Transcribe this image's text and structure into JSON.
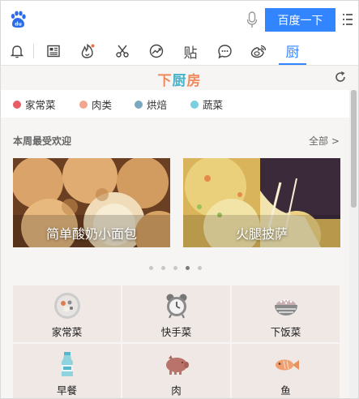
{
  "search": {
    "placeholder": "",
    "value": "",
    "button_label": "百度一下"
  },
  "toolbar": {
    "items": [
      {
        "icon": "bell-icon"
      },
      {
        "icon": "news-icon"
      },
      {
        "icon": "fire-icon"
      },
      {
        "icon": "scissors-icon"
      },
      {
        "icon": "chart-icon"
      },
      {
        "icon": "tieba-icon",
        "label": "贴"
      },
      {
        "icon": "chat-icon"
      },
      {
        "icon": "weibo-icon"
      },
      {
        "icon": "kitchen-icon",
        "label": "厨",
        "active": true
      }
    ]
  },
  "brand": {
    "part1": "下",
    "part2": "厨",
    "part3": "房"
  },
  "categories": [
    {
      "label": "家常菜",
      "color": "#e85d64"
    },
    {
      "label": "肉类",
      "color": "#f4a58e"
    },
    {
      "label": "烘焙",
      "color": "#7aa8bf"
    },
    {
      "label": "蔬菜",
      "color": "#79cfe0"
    }
  ],
  "weekly": {
    "title": "本周最受欢迎",
    "more_label": "全部 >",
    "cards": [
      {
        "caption": "简单酸奶小面包"
      },
      {
        "caption": "火腿披萨"
      }
    ],
    "pager": {
      "count": 5,
      "active_index": 3
    }
  },
  "grid": [
    {
      "label": "家常菜",
      "icon": "home-dish-icon"
    },
    {
      "label": "快手菜",
      "icon": "alarm-clock-icon"
    },
    {
      "label": "下饭菜",
      "icon": "rice-bowl-icon"
    },
    {
      "label": "早餐",
      "icon": "milk-bottle-icon"
    },
    {
      "label": "肉",
      "icon": "pig-icon"
    },
    {
      "label": "鱼",
      "icon": "fish-icon"
    }
  ]
}
